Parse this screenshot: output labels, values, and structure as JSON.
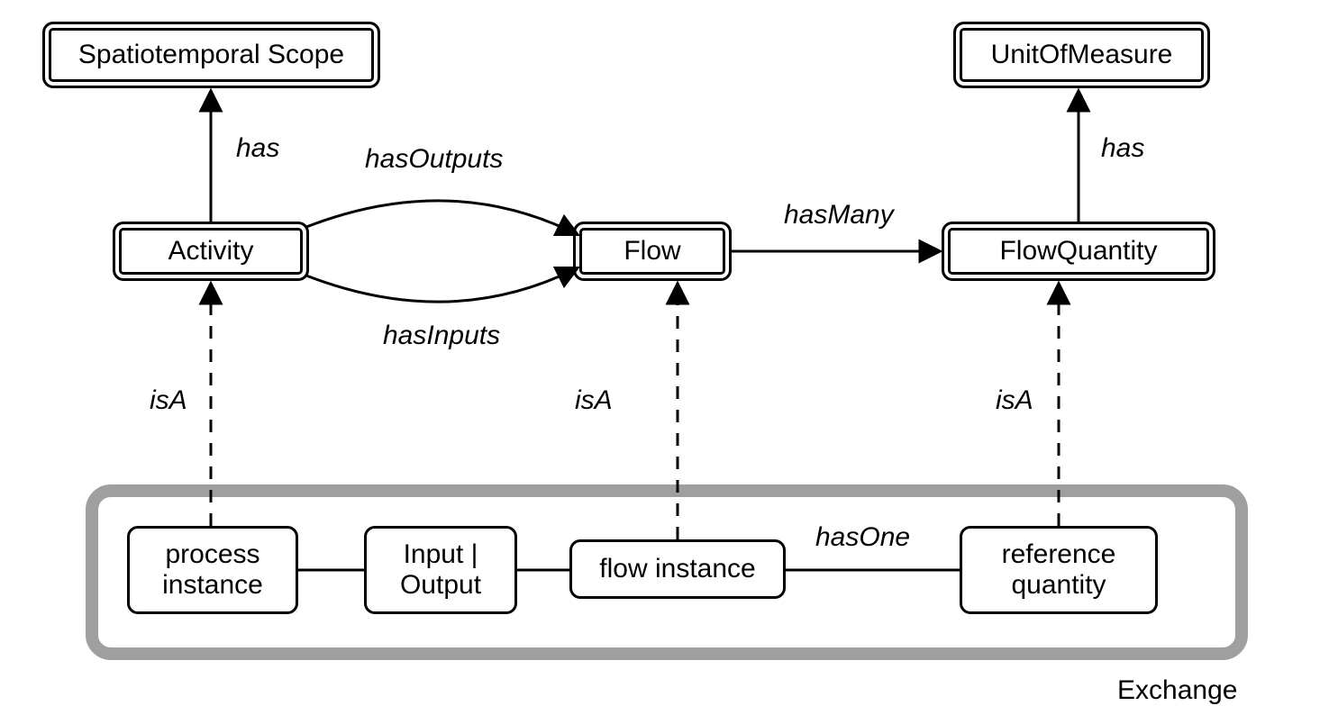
{
  "nodes": {
    "spatiotemporal": "Spatiotemporal Scope",
    "unitofmeasure": "UnitOfMeasure",
    "activity": "Activity",
    "flow": "Flow",
    "flowquantity": "FlowQuantity",
    "process_instance": "process\ninstance",
    "input_output": "Input |\nOutput",
    "flow_instance": "flow instance",
    "reference_quantity": "reference\nquantity"
  },
  "edges": {
    "has_left": "has",
    "has_right": "has",
    "hasOutputs": "hasOutputs",
    "hasInputs": "hasInputs",
    "hasMany": "hasMany",
    "isA1": "isA",
    "isA2": "isA",
    "isA3": "isA",
    "hasOne": "hasOne"
  },
  "container": {
    "exchange": "Exchange"
  }
}
